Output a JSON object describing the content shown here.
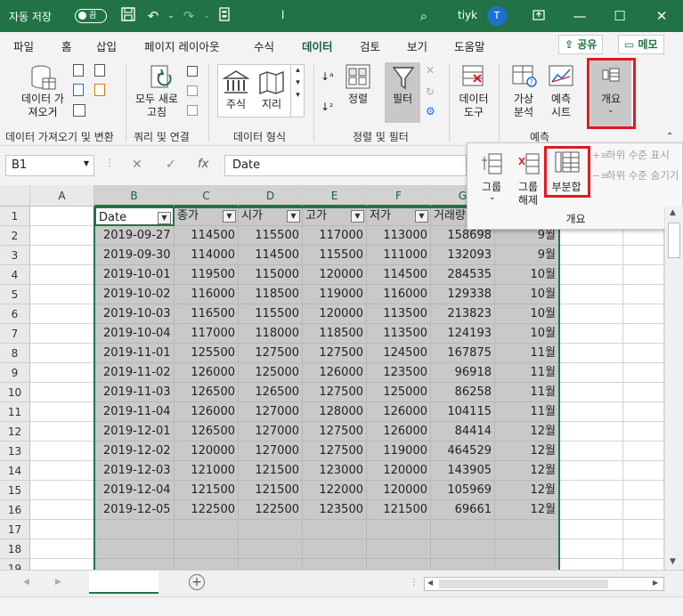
{
  "titlebar": {
    "autosave_label": "자동 저장",
    "toggle_state": "끔",
    "filename": "l",
    "user": "tiyk",
    "avatar_initial": "T"
  },
  "menu": {
    "tabs": [
      "파일",
      "홈",
      "삽입",
      "페이지 레이아웃",
      "수식",
      "데이터",
      "검토",
      "보기",
      "도움말"
    ],
    "active_tab": "데이터",
    "share_label": "공유",
    "comment_label": "메모"
  },
  "ribbon": {
    "get_data_label": "데이터 가\n져오기",
    "refresh_all_label": "모두 새로\n고침",
    "stocks_label": "주식",
    "geography_label": "지리",
    "sort_label": "정렬",
    "filter_label": "필터",
    "data_tools_label": "데이터\n도구",
    "what_if_label": "가상\n분석",
    "forecast_sheet_label": "예측\n시트",
    "outline_label": "개요",
    "groups": {
      "get_transform": "데이터 가져오기 및 변환",
      "queries": "쿼리 및 연결",
      "data_types": "데이터 형식",
      "sort_filter": "정렬 및 필터",
      "forecast": "예측"
    }
  },
  "outline_popup": {
    "group_label": "그룹",
    "ungroup_label": "그룹\n해제",
    "subtotal_label": "부분합",
    "show_detail_label": "하위 수준 표시",
    "hide_detail_label": "하위 수준 숨기기",
    "footer_label": "개요"
  },
  "formula_bar": {
    "name_box": "B1",
    "formula": "Date"
  },
  "sheet": {
    "columns": [
      "A",
      "B",
      "C",
      "D",
      "E",
      "F",
      "G"
    ],
    "headers": [
      "Date",
      "종가",
      "시가",
      "고가",
      "저가",
      "거래량",
      ""
    ],
    "rows": [
      [
        "2019-09-27",
        "114500",
        "115500",
        "117000",
        "113000",
        "158698",
        "9월"
      ],
      [
        "2019-09-30",
        "114000",
        "114500",
        "115500",
        "111000",
        "132093",
        "9월"
      ],
      [
        "2019-10-01",
        "119500",
        "115000",
        "120000",
        "114500",
        "284535",
        "10월"
      ],
      [
        "2019-10-02",
        "116000",
        "118500",
        "119000",
        "116000",
        "129338",
        "10월"
      ],
      [
        "2019-10-03",
        "116500",
        "115500",
        "120000",
        "113500",
        "213823",
        "10월"
      ],
      [
        "2019-10-04",
        "117000",
        "118000",
        "118500",
        "113500",
        "124193",
        "10월"
      ],
      [
        "2019-11-01",
        "125500",
        "127500",
        "127500",
        "124500",
        "167875",
        "11월"
      ],
      [
        "2019-11-02",
        "126000",
        "125000",
        "126000",
        "123500",
        "96918",
        "11월"
      ],
      [
        "2019-11-03",
        "126500",
        "126500",
        "127500",
        "125000",
        "86258",
        "11월"
      ],
      [
        "2019-11-04",
        "126000",
        "127000",
        "128000",
        "126000",
        "104115",
        "11월"
      ],
      [
        "2019-12-01",
        "126500",
        "127000",
        "127500",
        "126000",
        "84414",
        "12월"
      ],
      [
        "2019-12-02",
        "120000",
        "127000",
        "127500",
        "119000",
        "464529",
        "12월"
      ],
      [
        "2019-12-03",
        "121000",
        "121500",
        "123000",
        "120000",
        "143905",
        "12월"
      ],
      [
        "2019-12-04",
        "121500",
        "121500",
        "122000",
        "120000",
        "105969",
        "12월"
      ],
      [
        "2019-12-05",
        "122500",
        "122500",
        "123500",
        "121500",
        "69661",
        "12월"
      ]
    ],
    "row_numbers": [
      "1",
      "2",
      "3",
      "4",
      "5",
      "6",
      "7",
      "8",
      "9",
      "10",
      "11",
      "12",
      "13",
      "14",
      "15",
      "16",
      "17",
      "18",
      "19"
    ]
  },
  "icons": {
    "undo": "undo-icon",
    "redo": "redo-icon",
    "save": "save-icon",
    "search": "search-icon",
    "filter": "funnel-icon"
  },
  "colors": {
    "accent": "#217346",
    "highlight": "#e1191f",
    "selection": "#c9c9c9"
  }
}
